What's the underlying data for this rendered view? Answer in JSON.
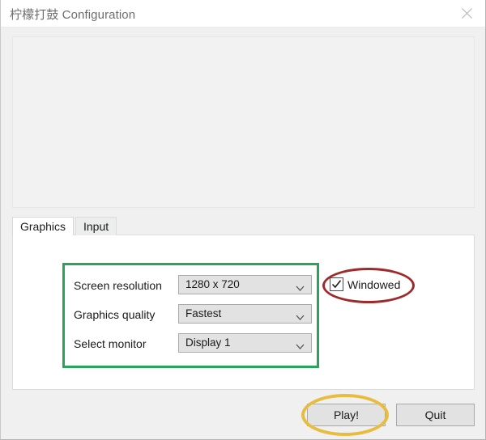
{
  "window": {
    "title": "柠檬打鼓 Configuration",
    "close_icon": "close-icon"
  },
  "banner": {
    "content": ""
  },
  "tabs": [
    {
      "label": "Graphics",
      "active": true
    },
    {
      "label": "Input",
      "active": false
    }
  ],
  "graphics": {
    "rows": [
      {
        "label": "Screen resolution",
        "value": "1280 x 720",
        "icon": "chevron-down-icon"
      },
      {
        "label": "Graphics quality",
        "value": "Fastest",
        "icon": "chevron-down-icon"
      },
      {
        "label": "Select monitor",
        "value": "Display 1",
        "icon": "chevron-down-icon"
      }
    ],
    "windowed": {
      "label": "Windowed",
      "checked": true,
      "icon": "check-icon"
    }
  },
  "buttons": {
    "play_label": "Play!",
    "quit_label": "Quit"
  },
  "annotations": {
    "green_rect_color": "#2aa45a",
    "red_ellipse_color": "#9e2b2b",
    "yellow_ellipse_color": "#e8bc3e"
  },
  "colors": {
    "titlebar_bg": "#ffffff",
    "window_bg": "#f0f0f0",
    "panel_bg": "#ffffff",
    "banner_bg": "#f2f2f2",
    "control_bg": "#e2e2e2",
    "control_border": "#a9a9a9",
    "text": "#1a1a1a",
    "title_text": "#6d6d6d"
  }
}
